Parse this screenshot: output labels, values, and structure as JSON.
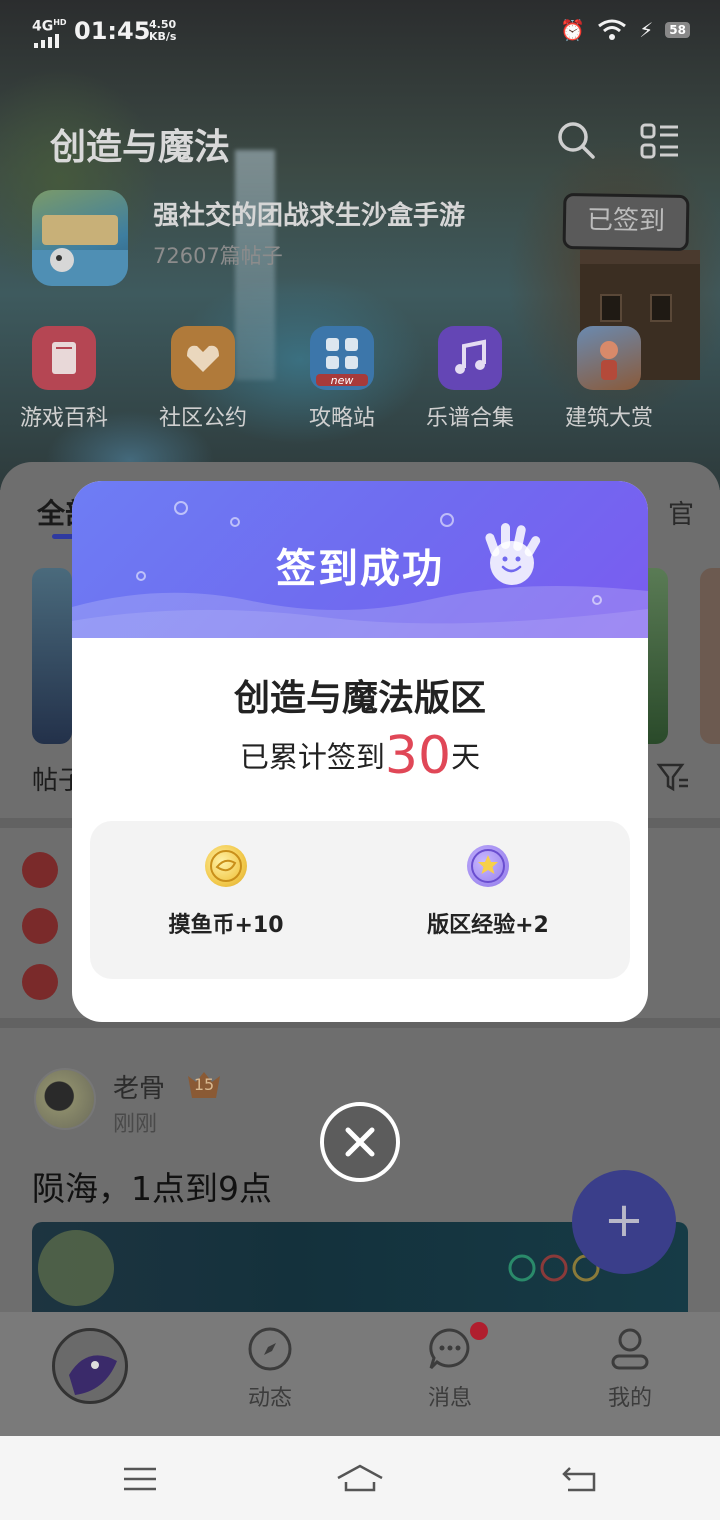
{
  "status_bar": {
    "network": "4G",
    "network_sup": "HD",
    "time": "01:45",
    "speed_value": "4.50",
    "speed_unit": "KB/s",
    "battery": "58"
  },
  "header": {
    "forum_title": "创造与魔法",
    "game_description": "强社交的团战求生沙盒手游",
    "post_count": "72607篇帖子",
    "signed_label": "已签到"
  },
  "shortcuts": [
    {
      "label": "游戏百科",
      "icon": "book-icon",
      "color": "#c54a57"
    },
    {
      "label": "社区公约",
      "icon": "handshake-icon",
      "color": "#b9813c"
    },
    {
      "label": "攻略站",
      "icon": "grid-new-icon",
      "color": "#3f7bb0"
    },
    {
      "label": "乐谱合集",
      "icon": "music-note-icon",
      "color": "#6a4bbf"
    },
    {
      "label": "建筑大赏",
      "icon": "character-icon",
      "color": "#7a6048"
    }
  ],
  "feed": {
    "tab_left_partial": "全部",
    "tab_right_partial": "官",
    "posts_label_partial": "帖子",
    "post": {
      "author": "老骨",
      "level": "15",
      "time": "刚刚",
      "title": "陨海，1点到9点"
    }
  },
  "dialog": {
    "title": "签到成功",
    "forum_name": "创造与魔法版区",
    "days_prefix": "已累计签到",
    "days_count": "30",
    "days_suffix": "天",
    "rewards": [
      {
        "label": "摸鱼币+10",
        "icon": "coin-icon"
      },
      {
        "label": "版区经验+2",
        "icon": "star-medal-icon"
      }
    ]
  },
  "bottom_nav": [
    {
      "label": "动态",
      "icon": "compass-icon"
    },
    {
      "label": "消息",
      "icon": "chat-bubble-icon"
    },
    {
      "label": "我的",
      "icon": "profile-icon"
    }
  ],
  "colors": {
    "dialog_header_start": "#6e7df4",
    "dialog_header_end": "#7a5cf0",
    "days_highlight": "#e04757",
    "fab": "#5b62e0"
  }
}
